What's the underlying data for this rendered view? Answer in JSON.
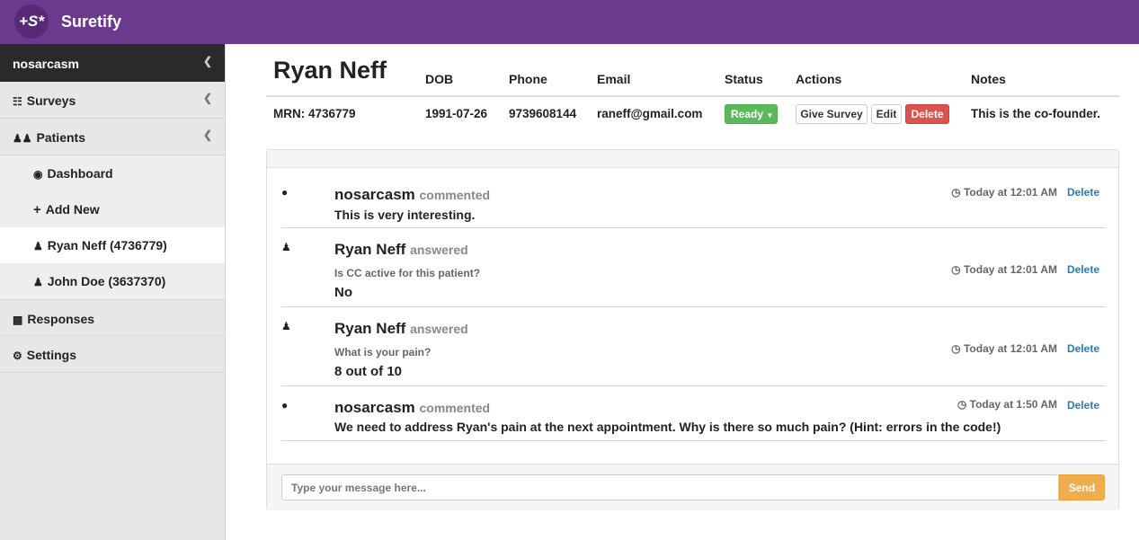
{
  "app": {
    "logo_text": "+S*",
    "brand": "Suretify"
  },
  "sidebar": {
    "user": "nosarcasm",
    "items": [
      {
        "label": "Surveys",
        "icon": "sitemap-icon"
      },
      {
        "label": "Patients",
        "icon": "users-icon"
      },
      {
        "label": "Dashboard",
        "icon": "dashboard-icon"
      },
      {
        "label": "Add New",
        "icon": "plus-icon"
      },
      {
        "label": "Ryan Neff (4736779)",
        "icon": "user-icon"
      },
      {
        "label": "John Doe (3637370)",
        "icon": "user-icon"
      },
      {
        "label": "Responses",
        "icon": "bar-chart-icon"
      },
      {
        "label": "Settings",
        "icon": "cogs-icon"
      }
    ]
  },
  "patient": {
    "name": "Ryan Neff",
    "headers": {
      "dob": "DOB",
      "phone": "Phone",
      "email": "Email",
      "status": "Status",
      "actions": "Actions",
      "notes": "Notes"
    },
    "mrn": "MRN: 4736779",
    "dob": "1991-07-26",
    "phone": "9739608144",
    "email": "raneff@gmail.com",
    "status": "Ready",
    "actions": {
      "give_survey": "Give Survey",
      "edit": "Edit",
      "delete": "Delete"
    },
    "notes": "This is the co-founder."
  },
  "feed": {
    "entries": [
      {
        "icon": "comment-icon",
        "author": "nosarcasm",
        "verb": "commented",
        "text": "This is very interesting.",
        "time": "Today at 12:01 AM",
        "delete": "Delete"
      },
      {
        "icon": "user-icon",
        "author": "Ryan Neff",
        "verb": "answered",
        "question": "Is CC active for this patient?",
        "answer": "No",
        "time": "Today at 12:01 AM",
        "delete": "Delete"
      },
      {
        "icon": "user-icon",
        "author": "Ryan Neff",
        "verb": "answered",
        "question": "What is your pain?",
        "answer": "8 out of 10",
        "time": "Today at 12:01 AM",
        "delete": "Delete"
      },
      {
        "icon": "comment-icon",
        "author": "nosarcasm",
        "verb": "commented",
        "text": "We need to address Ryan's pain at the next appointment. Why is there so much pain? (Hint: errors in the code!)",
        "time": "Today at 1:50 AM",
        "delete": "Delete"
      }
    ],
    "input_placeholder": "Type your message here...",
    "send_label": "Send"
  },
  "colors": {
    "topbar": "#6b3a8c",
    "ready": "#5cb85c",
    "delete": "#d9534f",
    "send": "#f0ad4e",
    "link": "#337ab7"
  }
}
